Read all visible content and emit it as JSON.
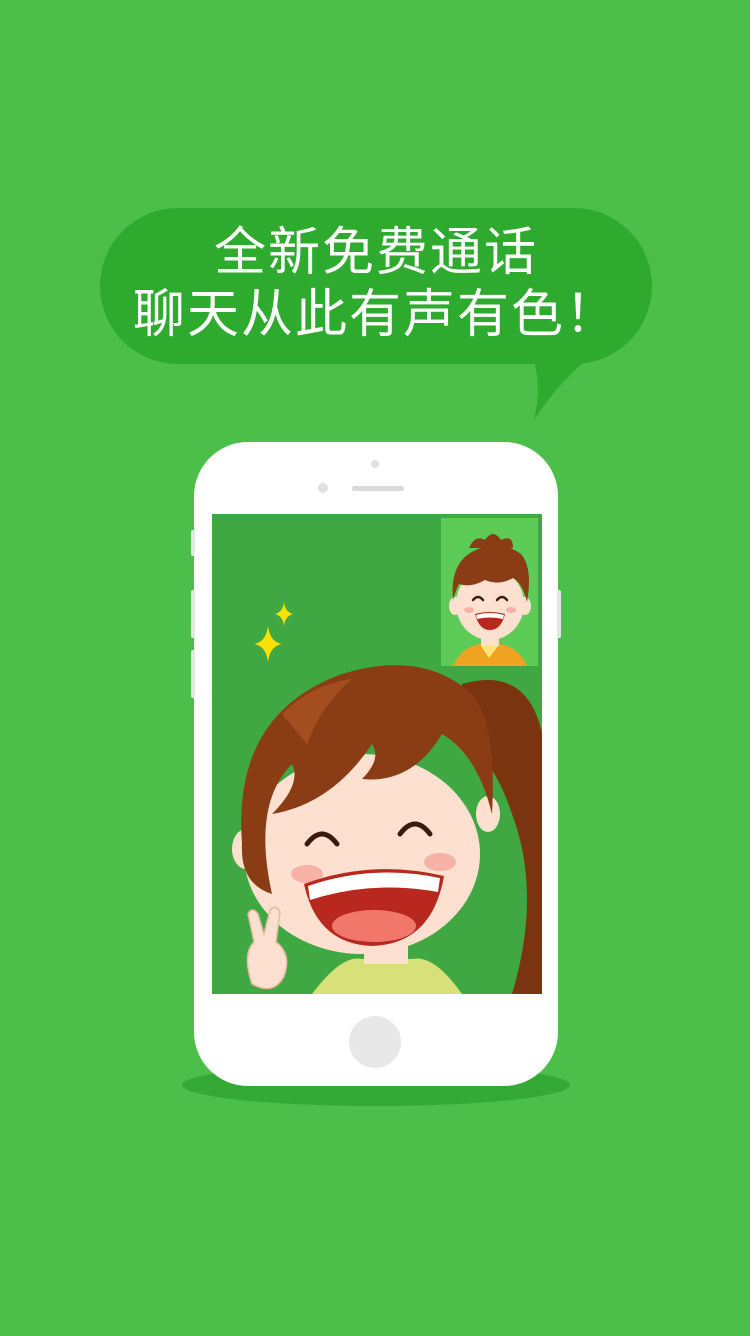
{
  "promo": {
    "line1": "全新免费通话",
    "line2": "聊天从此有声有色！"
  },
  "colors": {
    "background": "#4cbf4b",
    "bubble": "#2eaa2e",
    "screen": "#3fa842",
    "pip": "#5ccc56"
  },
  "icons": {
    "sparkle": "sparkle-icon",
    "phone": "smartphone-illustration"
  }
}
